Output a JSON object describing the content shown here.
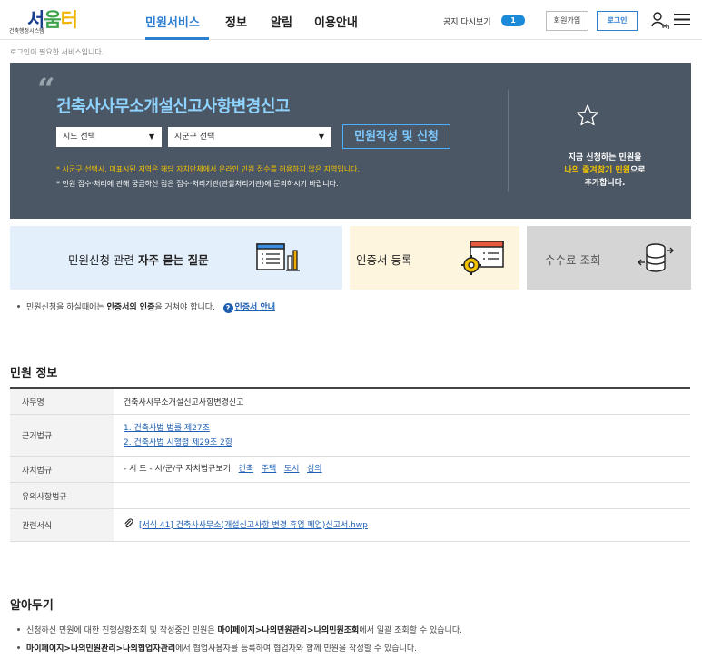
{
  "header": {
    "logo_text_a": "서",
    "logo_text_b": "움",
    "logo_text_c": "터",
    "logo_subtitle": "건축행정시스템",
    "nav": [
      "민원서비스",
      "정보",
      "알림",
      "이용안내"
    ],
    "notice_label": "공지 다시보기",
    "notice_count": "1",
    "join_label": "회원가입",
    "login_label": "로그인",
    "my_label": "My"
  },
  "login_notice": "로그인이 필요한 서비스입니다.",
  "hero": {
    "quote": "“",
    "title": "건축사사무소개설신고사항변경신고",
    "sido_select": "시도 선택",
    "sigungu_select": "시군구 선택",
    "apply_button": "민원작성 및 신청",
    "note1": "* 시군구 선택시, 미표시된 지역은 해당 자치단체에서 온라인 민원 접수를 허용하지 않은 지역입니다.",
    "note2": "* 민원 접수·처리에 관해 궁금하신 점은 접수·처리기관(관할처리기관)에 문의하시기 바랍니다.",
    "fav_line1": "지금 신청하는 민원을",
    "fav_line2_hl": "나의 즐겨찾기 민원",
    "fav_line2_rest": "으로",
    "fav_line3": "추가합니다."
  },
  "cards": {
    "faq_prefix": "민원신청 관련 ",
    "faq_bold": "자주 묻는 질문",
    "cert": "인증서 등록",
    "fee": "수수료 조회"
  },
  "cert_note": {
    "prefix": "민원신청을 하실때에는 ",
    "bold": "인증서의 인증",
    "suffix": "을 거쳐야 합니다.",
    "link": "인증서 안내"
  },
  "info": {
    "title": "민원 정보",
    "rows": {
      "name_label": "사무명",
      "name_value": "건축사사무소개설신고사항변경신고",
      "law_label": "근거법규",
      "law1": "1. 건축사법 법률 제27조",
      "law2": "2. 건축사법 시행령 제29조 2항",
      "local_label": "자치법규",
      "local_prefix": "- 시 도 - 시/군/구 자치법규보기",
      "local_links": [
        "건축",
        "주택",
        "도시",
        "심의"
      ],
      "caution_label": "유의사항법규",
      "form_label": "관련서식",
      "form_link": "[서식 41] 건축사사무소(개설신고사항 변경 휴업 폐업)신고서.hwp"
    }
  },
  "know": {
    "title": "알아두기",
    "item1_prefix": "신청하신 민원에 대한 진행상황조회 및 작성중인 민원은 ",
    "item1_bold": "마이페이지>나의민원관리>나의민원조회",
    "item1_suffix": "에서 일괄 조회할 수 있습니다.",
    "item2_bold": "마이페이지>나의민원관리>나의협업자관리",
    "item2_suffix": "에서 협업사용자를 등록하여 협업자와 함께 민원을 작성할 수 있습니다."
  }
}
